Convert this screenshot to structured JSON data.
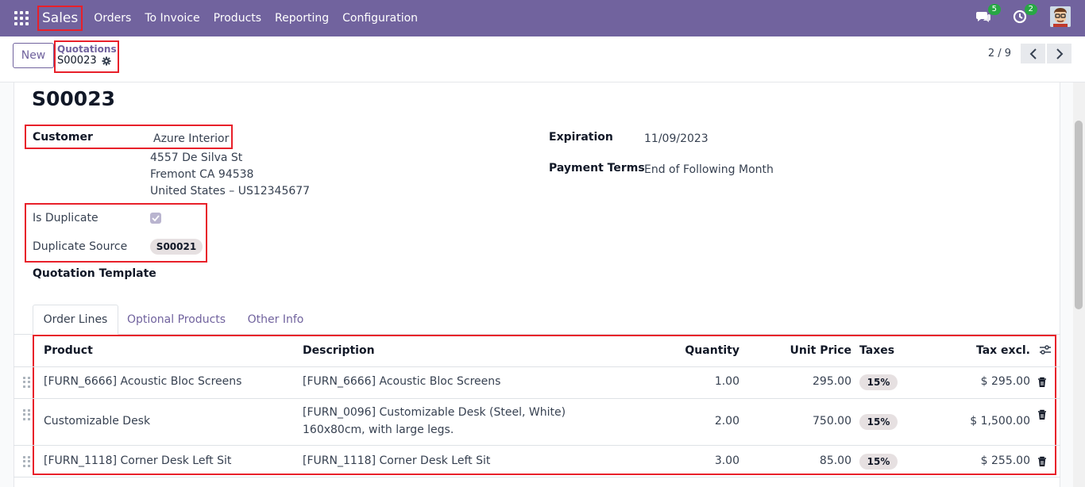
{
  "navbar": {
    "brand": "Sales",
    "menu": [
      "Orders",
      "To Invoice",
      "Products",
      "Reporting",
      "Configuration"
    ],
    "messages_count": "5",
    "activities_count": "2"
  },
  "control_panel": {
    "new_label": "New",
    "breadcrumb_parent": "Quotations",
    "breadcrumb_current": "S00023",
    "pager_value": "2 / 9"
  },
  "form": {
    "record_name": "S00023",
    "customer_label": "Customer",
    "customer_name": "Azure Interior",
    "address_line1": "4557 De Silva St",
    "address_line2": "Fremont CA 94538",
    "address_line3": "United States – US12345677",
    "is_duplicate_label": "Is Duplicate",
    "is_duplicate": true,
    "duplicate_source_label": "Duplicate Source",
    "duplicate_source": "S00021",
    "quotation_template_label": "Quotation Template",
    "expiration_label": "Expiration",
    "expiration": "11/09/2023",
    "payment_terms_label": "Payment Terms",
    "payment_terms": "End of Following Month"
  },
  "tabs": [
    "Order Lines",
    "Optional Products",
    "Other Info"
  ],
  "order_lines": {
    "headers": {
      "product": "Product",
      "description": "Description",
      "quantity": "Quantity",
      "unit_price": "Unit Price",
      "taxes": "Taxes",
      "tax_excl": "Tax excl."
    },
    "rows": [
      {
        "product": "[FURN_6666] Acoustic Bloc Screens",
        "description_line1": "[FURN_6666] Acoustic Bloc Screens",
        "description_line2": "",
        "quantity": "1.00",
        "unit_price": "295.00",
        "tax": "15%",
        "subtotal": "$ 295.00"
      },
      {
        "product": "Customizable Desk",
        "description_line1": "[FURN_0096] Customizable Desk (Steel, White)",
        "description_line2": "160x80cm, with large legs.",
        "quantity": "2.00",
        "unit_price": "750.00",
        "tax": "15%",
        "subtotal": "$ 1,500.00"
      },
      {
        "product": "[FURN_1118] Corner Desk Left Sit",
        "description_line1": "[FURN_1118] Corner Desk Left Sit",
        "description_line2": "",
        "quantity": "3.00",
        "unit_price": "85.00",
        "tax": "15%",
        "subtotal": "$ 255.00"
      }
    ]
  },
  "colors": {
    "brand_purple": "#71639e",
    "highlight_red": "#e8202a",
    "badge_green": "#28a745"
  },
  "icons": [
    "apps-grid-icon",
    "chat-icon",
    "clock-icon",
    "gear-icon",
    "chevron-left-icon",
    "chevron-right-icon",
    "checkmark-icon",
    "drag-handle-icon",
    "trash-icon",
    "column-settings-icon"
  ]
}
